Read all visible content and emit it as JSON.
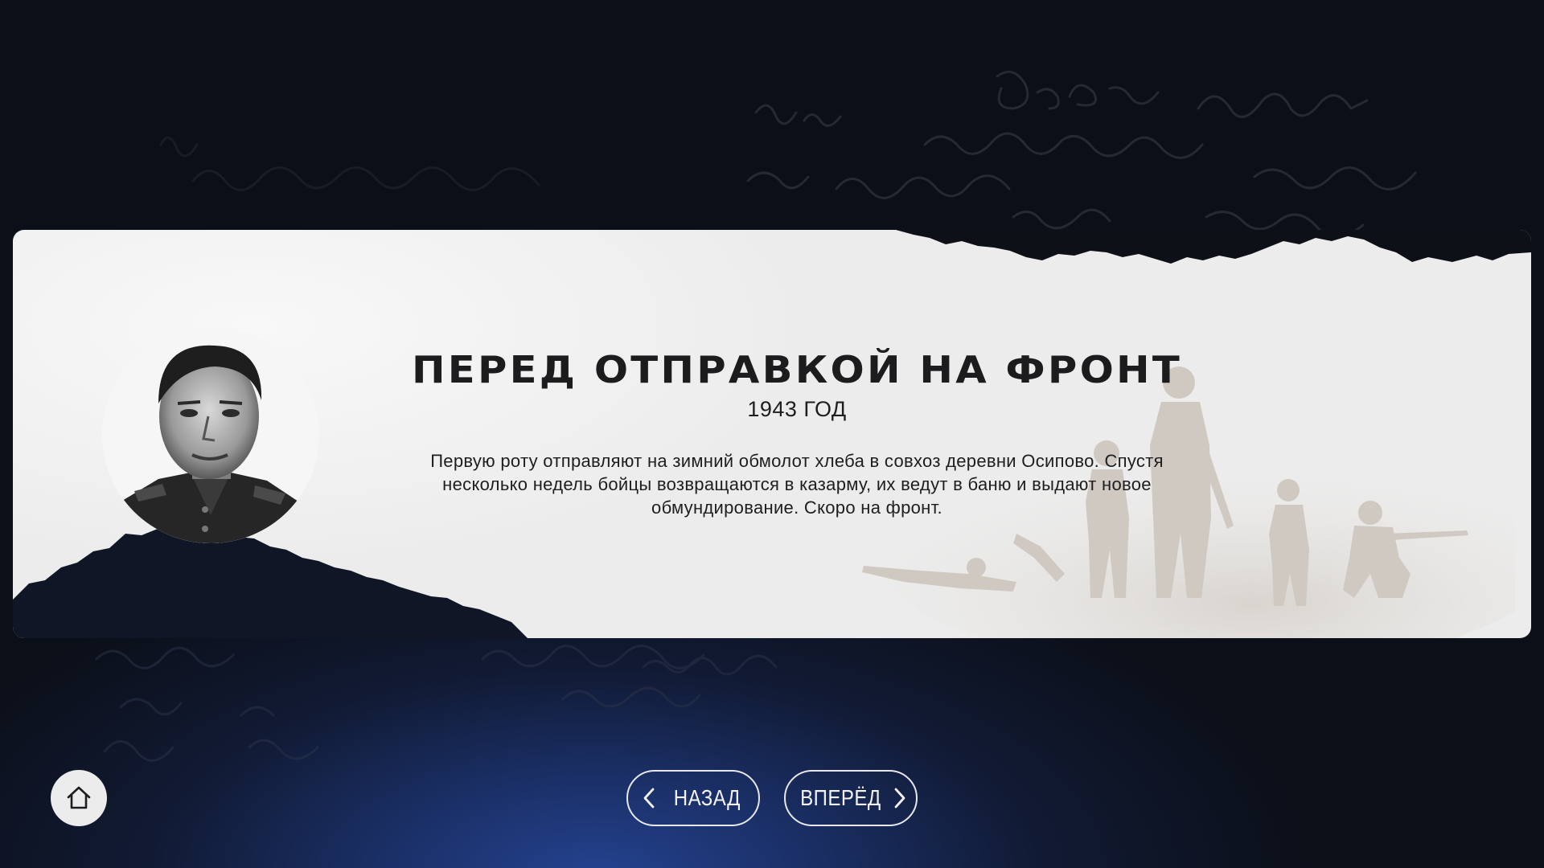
{
  "slide": {
    "title": "ПЕРЕД ОТПРАВКОЙ НА ФРОНТ",
    "year": "1943 ГОД",
    "description": "Первую роту отправляют на зимний обмолот хлеба в совхоз деревни Осипово. Спустя несколько недель бойцы возвращаются в казарму, их ведут в баню и выдают новое обмундирование. Скоро на фронт."
  },
  "navigation": {
    "back_label": "НАЗАД",
    "next_label": "ВПЕРЁД",
    "home_icon": "home-icon",
    "back_icon": "chevron-left-icon",
    "next_icon": "chevron-right-icon"
  },
  "colors": {
    "background": "#0b0f18",
    "glow": "#24428f",
    "card": "#f1f1f1",
    "text": "#1c1c1e",
    "button_border": "#e8e8ec"
  }
}
